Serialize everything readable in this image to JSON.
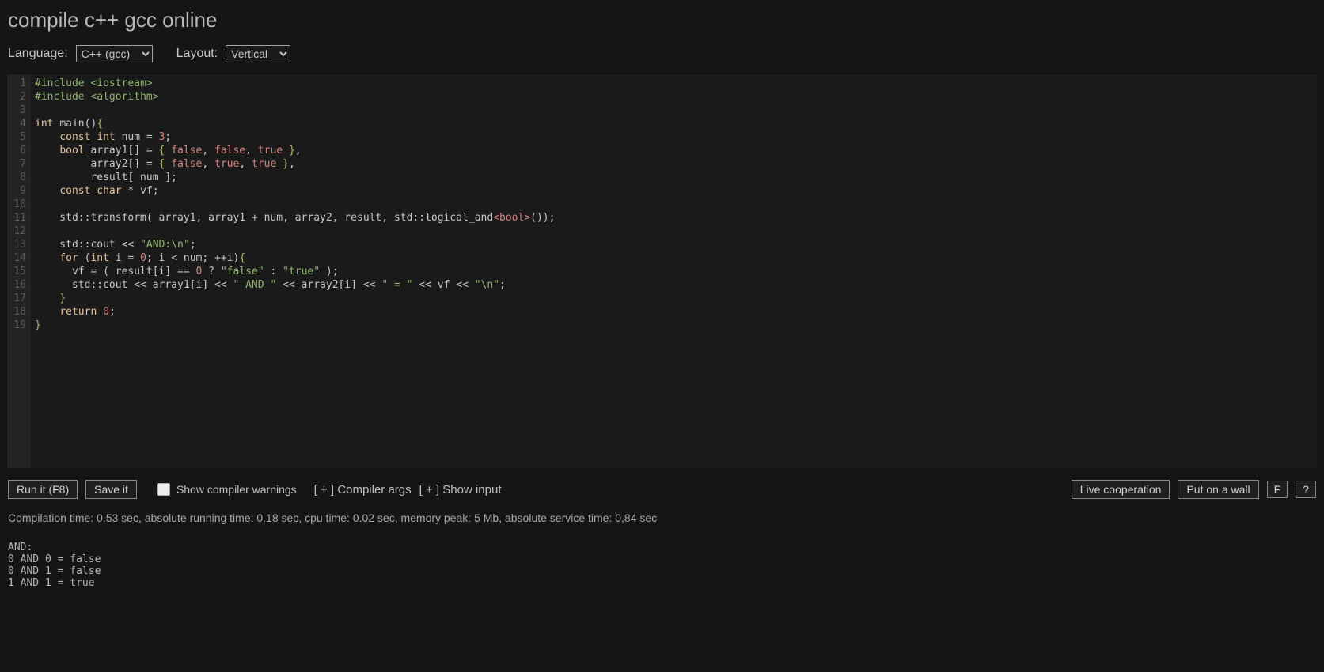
{
  "title": "compile c++ gcc online",
  "controls": {
    "language_label": "Language:",
    "language_value": "C++ (gcc)",
    "layout_label": "Layout:",
    "layout_value": "Vertical"
  },
  "editor": {
    "line_count": 19,
    "code_raw": "#include <iostream>\n#include <algorithm>\n\nint main(){\n    const int num = 3;\n    bool array1[] = { false, false, true },\n         array2[] = { false, true, true },\n         result[ num ];\n    const char * vf;\n\n    std::transform( array1, array1 + num, array2, result, std::logical_and<bool>());\n\n    std::cout << \"AND:\\n\";\n    for (int i = 0; i < num; ++i){\n      vf = ( result[i] == 0 ? \"false\" : \"true\" );\n      std::cout << array1[i] << \" AND \" << array2[i] << \" = \" << vf << \"\\n\";\n    }\n    return 0;\n}",
    "code_html": [
      "<span class='tok-pp'>#include</span> <span class='tok-str'>&lt;iostream&gt;</span>",
      "<span class='tok-pp'>#include</span> <span class='tok-str'>&lt;algorithm&gt;</span>",
      "",
      "<span class='tok-kw'>int</span> <span class='tok-name'>main</span>()<span class='tok-brace'>{</span>",
      "    <span class='tok-kw'>const</span> <span class='tok-kw'>int</span> num = <span class='tok-num'>3</span>;",
      "    <span class='tok-kw'>bool</span> array1[] = <span class='tok-brace'>{</span> <span class='tok-bool'>false</span>, <span class='tok-bool'>false</span>, <span class='tok-bool'>true</span> <span class='tok-brace'>}</span>,",
      "         array2[] = <span class='tok-brace'>{</span> <span class='tok-bool'>false</span>, <span class='tok-bool'>true</span>, <span class='tok-bool'>true</span> <span class='tok-brace'>}</span>,",
      "         result[ num ];",
      "    <span class='tok-kw'>const</span> <span class='tok-kw'>char</span> * vf;",
      "",
      "    std::transform( array1, array1 + num, array2, result, std::logical_and<span class='tok-tmpl'>&lt;bool&gt;</span>());",
      "",
      "    std::cout &lt;&lt; <span class='tok-str'>\"AND:\\n\"</span>;",
      "    <span class='tok-kw'>for</span> (<span class='tok-kw'>int</span> i = <span class='tok-num'>0</span>; i &lt; num; ++i)<span class='tok-brace'>{</span>",
      "      vf = ( result[i] == <span class='tok-num'>0</span> ? <span class='tok-str'>\"false\"</span> : <span class='tok-str'>\"true\"</span> );",
      "      std::cout &lt;&lt; array1[i] &lt;&lt; <span class='tok-str'>\" AND \"</span> &lt;&lt; array2[i] &lt;&lt; <span class='tok-str'>\" = \"</span> &lt;&lt; vf &lt;&lt; <span class='tok-str'>\"\\n\"</span>;",
      "    <span class='tok-brace'>}</span>",
      "    <span class='tok-kw'>return</span> <span class='tok-num'>0</span>;",
      "<span class='tok-brace'>}</span>"
    ]
  },
  "toolbar": {
    "run_label": "Run it (F8)",
    "save_label": "Save it",
    "show_warnings_label": "Show compiler warnings",
    "compiler_args_label": "Compiler args",
    "show_input_label": "Show input",
    "plus_left": "[ + ]",
    "plus_right": "[ + ]",
    "live_coop_label": "Live cooperation",
    "put_wall_label": "Put on a wall",
    "f_label": "F",
    "help_label": "?"
  },
  "result": {
    "stats": "Compilation time: 0.53 sec, absolute running time: 0.18 sec, cpu time: 0.02 sec, memory peak: 5 Mb, absolute service time: 0,84 sec",
    "output": "AND:\n0 AND 0 = false\n0 AND 1 = false\n1 AND 1 = true"
  }
}
